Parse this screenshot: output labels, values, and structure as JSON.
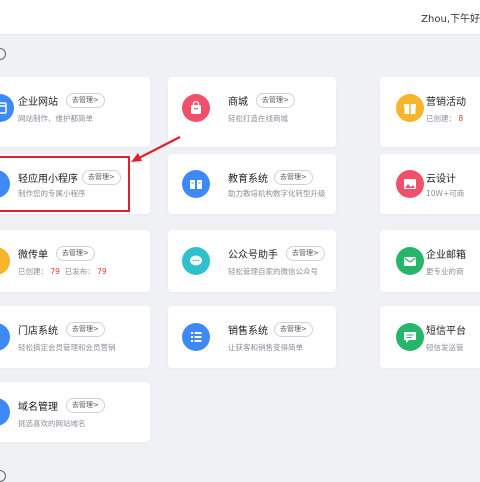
{
  "header": {
    "greeting": "Zhou,下午好"
  },
  "manage_label": "去管理>",
  "colors": {
    "accent_red": "#e0202a",
    "number_red": "#e0412e"
  },
  "cards": [
    {
      "id": "enterprise-site",
      "title": "企业网站",
      "desc": "网站制作、维护都简单",
      "icon": "website-icon",
      "color": "#3d8af7"
    },
    {
      "id": "mall",
      "title": "商城",
      "desc": "轻松打造在线商城",
      "icon": "shopping-bag-icon",
      "color": "#f2506a"
    },
    {
      "id": "marketing",
      "title": "营销活动",
      "desc_label": "已创建：",
      "desc_value": "8",
      "icon": "gift-icon",
      "color": "#f7b52c"
    },
    {
      "id": "mini-program",
      "title": "轻应用小程序",
      "desc": "制作您的专属小程序",
      "icon": "mini-program-icon",
      "color": "#3d8af7"
    },
    {
      "id": "education",
      "title": "教育系统",
      "desc": "助力教培机构数字化转型升级",
      "icon": "book-icon",
      "color": "#3d8af7"
    },
    {
      "id": "cloud-design",
      "title": "云设计",
      "desc": "10W+可商",
      "icon": "image-icon",
      "color": "#f2506a"
    },
    {
      "id": "micro-flyer",
      "title": "微传单",
      "desc_label": "已创建：",
      "desc_value": "79",
      "desc_label2": "已发布：",
      "desc_value2": "79",
      "icon": "flyer-icon",
      "color": "#f7b52c"
    },
    {
      "id": "official-account",
      "title": "公众号助手",
      "desc": "轻松管理自家的微信公众号",
      "icon": "chat-icon",
      "color": "#2ec1cc"
    },
    {
      "id": "enterprise-mail",
      "title": "企业邮箱",
      "desc": "更专业的商",
      "icon": "mail-icon",
      "color": "#27b56a"
    },
    {
      "id": "store-system",
      "title": "门店系统",
      "desc": "轻松搞定会员管理和会员营销",
      "icon": "store-icon",
      "color": "#3d8af7"
    },
    {
      "id": "sales-system",
      "title": "销售系统",
      "desc": "让获客和销售变得简单",
      "icon": "list-icon",
      "color": "#3d8af7"
    },
    {
      "id": "sms-platform",
      "title": "短信平台",
      "desc": "短信发送管",
      "icon": "sms-icon",
      "color": "#27b56a"
    },
    {
      "id": "domain",
      "title": "域名管理",
      "desc": "挑选喜欢的网站域名",
      "icon": "domain-icon",
      "color": "#3d8af7"
    }
  ]
}
